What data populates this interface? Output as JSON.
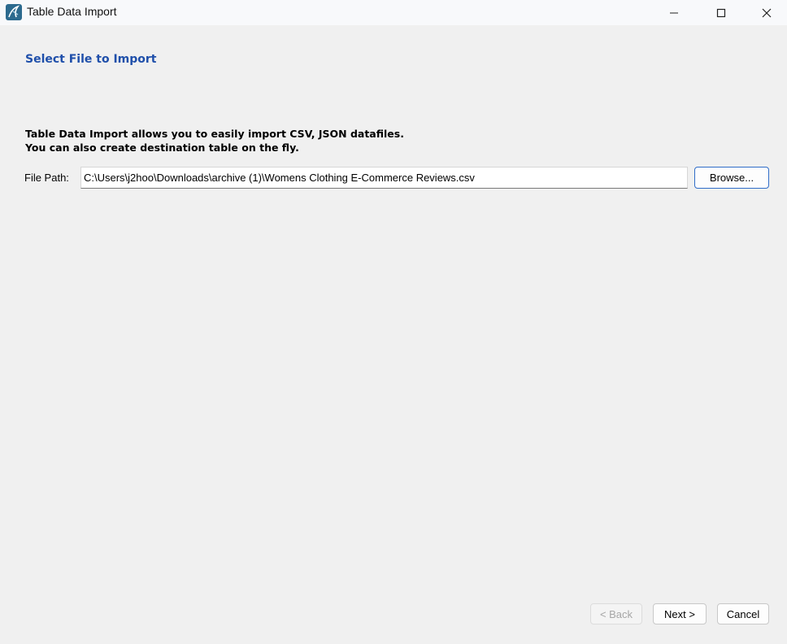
{
  "window": {
    "title": "Table Data Import",
    "icon": "mysql-workbench-icon"
  },
  "page": {
    "heading": "Select File to Import",
    "description_line1": "Table Data Import allows you to easily import CSV, JSON datafiles.",
    "description_line2": "You can also create destination table on the fly."
  },
  "file_path": {
    "label": "File Path:",
    "value": "C:\\Users\\j2hoo\\Downloads\\archive (1)\\Womens Clothing E-Commerce Reviews.csv",
    "browse_label": "Browse..."
  },
  "footer": {
    "back_label": "< Back",
    "next_label": "Next >",
    "cancel_label": "Cancel"
  },
  "colors": {
    "heading": "#1f4faa",
    "focus_border": "#2f6cc7"
  }
}
